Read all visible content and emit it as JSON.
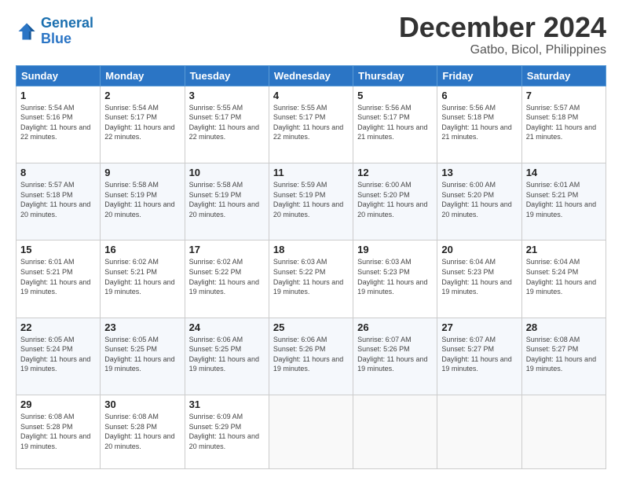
{
  "header": {
    "logo_line1": "General",
    "logo_line2": "Blue",
    "title": "December 2024",
    "subtitle": "Gatbo, Bicol, Philippines"
  },
  "calendar": {
    "columns": [
      "Sunday",
      "Monday",
      "Tuesday",
      "Wednesday",
      "Thursday",
      "Friday",
      "Saturday"
    ],
    "weeks": [
      [
        null,
        {
          "day": "2",
          "sunrise": "5:54 AM",
          "sunset": "5:17 PM",
          "daylight": "11 hours and 22 minutes."
        },
        {
          "day": "3",
          "sunrise": "5:55 AM",
          "sunset": "5:17 PM",
          "daylight": "11 hours and 22 minutes."
        },
        {
          "day": "4",
          "sunrise": "5:55 AM",
          "sunset": "5:17 PM",
          "daylight": "11 hours and 22 minutes."
        },
        {
          "day": "5",
          "sunrise": "5:56 AM",
          "sunset": "5:17 PM",
          "daylight": "11 hours and 21 minutes."
        },
        {
          "day": "6",
          "sunrise": "5:56 AM",
          "sunset": "5:18 PM",
          "daylight": "11 hours and 21 minutes."
        },
        {
          "day": "7",
          "sunrise": "5:57 AM",
          "sunset": "5:18 PM",
          "daylight": "11 hours and 21 minutes."
        }
      ],
      [
        {
          "day": "1",
          "sunrise": "5:54 AM",
          "sunset": "5:16 PM",
          "daylight": "11 hours and 22 minutes."
        },
        null,
        null,
        null,
        null,
        null,
        null
      ],
      [
        {
          "day": "8",
          "sunrise": "5:57 AM",
          "sunset": "5:18 PM",
          "daylight": "11 hours and 20 minutes."
        },
        {
          "day": "9",
          "sunrise": "5:58 AM",
          "sunset": "5:19 PM",
          "daylight": "11 hours and 20 minutes."
        },
        {
          "day": "10",
          "sunrise": "5:58 AM",
          "sunset": "5:19 PM",
          "daylight": "11 hours and 20 minutes."
        },
        {
          "day": "11",
          "sunrise": "5:59 AM",
          "sunset": "5:19 PM",
          "daylight": "11 hours and 20 minutes."
        },
        {
          "day": "12",
          "sunrise": "6:00 AM",
          "sunset": "5:20 PM",
          "daylight": "11 hours and 20 minutes."
        },
        {
          "day": "13",
          "sunrise": "6:00 AM",
          "sunset": "5:20 PM",
          "daylight": "11 hours and 20 minutes."
        },
        {
          "day": "14",
          "sunrise": "6:01 AM",
          "sunset": "5:21 PM",
          "daylight": "11 hours and 19 minutes."
        }
      ],
      [
        {
          "day": "15",
          "sunrise": "6:01 AM",
          "sunset": "5:21 PM",
          "daylight": "11 hours and 19 minutes."
        },
        {
          "day": "16",
          "sunrise": "6:02 AM",
          "sunset": "5:21 PM",
          "daylight": "11 hours and 19 minutes."
        },
        {
          "day": "17",
          "sunrise": "6:02 AM",
          "sunset": "5:22 PM",
          "daylight": "11 hours and 19 minutes."
        },
        {
          "day": "18",
          "sunrise": "6:03 AM",
          "sunset": "5:22 PM",
          "daylight": "11 hours and 19 minutes."
        },
        {
          "day": "19",
          "sunrise": "6:03 AM",
          "sunset": "5:23 PM",
          "daylight": "11 hours and 19 minutes."
        },
        {
          "day": "20",
          "sunrise": "6:04 AM",
          "sunset": "5:23 PM",
          "daylight": "11 hours and 19 minutes."
        },
        {
          "day": "21",
          "sunrise": "6:04 AM",
          "sunset": "5:24 PM",
          "daylight": "11 hours and 19 minutes."
        }
      ],
      [
        {
          "day": "22",
          "sunrise": "6:05 AM",
          "sunset": "5:24 PM",
          "daylight": "11 hours and 19 minutes."
        },
        {
          "day": "23",
          "sunrise": "6:05 AM",
          "sunset": "5:25 PM",
          "daylight": "11 hours and 19 minutes."
        },
        {
          "day": "24",
          "sunrise": "6:06 AM",
          "sunset": "5:25 PM",
          "daylight": "11 hours and 19 minutes."
        },
        {
          "day": "25",
          "sunrise": "6:06 AM",
          "sunset": "5:26 PM",
          "daylight": "11 hours and 19 minutes."
        },
        {
          "day": "26",
          "sunrise": "6:07 AM",
          "sunset": "5:26 PM",
          "daylight": "11 hours and 19 minutes."
        },
        {
          "day": "27",
          "sunrise": "6:07 AM",
          "sunset": "5:27 PM",
          "daylight": "11 hours and 19 minutes."
        },
        {
          "day": "28",
          "sunrise": "6:08 AM",
          "sunset": "5:27 PM",
          "daylight": "11 hours and 19 minutes."
        }
      ],
      [
        {
          "day": "29",
          "sunrise": "6:08 AM",
          "sunset": "5:28 PM",
          "daylight": "11 hours and 19 minutes."
        },
        {
          "day": "30",
          "sunrise": "6:08 AM",
          "sunset": "5:28 PM",
          "daylight": "11 hours and 20 minutes."
        },
        {
          "day": "31",
          "sunrise": "6:09 AM",
          "sunset": "5:29 PM",
          "daylight": "11 hours and 20 minutes."
        },
        null,
        null,
        null,
        null
      ]
    ]
  }
}
